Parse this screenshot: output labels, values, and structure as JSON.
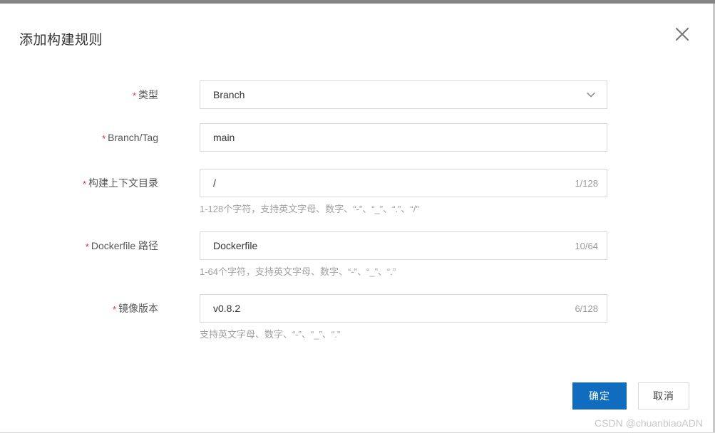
{
  "dialog": {
    "title": "添加构建规则",
    "close_icon": "close-icon"
  },
  "form": {
    "fields": [
      {
        "label": "类型",
        "required_mark": "*",
        "value": "Branch",
        "control": "select",
        "icon": "chevron-down-icon",
        "counter": "",
        "helper": ""
      },
      {
        "label": "Branch/Tag",
        "required_mark": "*",
        "value": "main",
        "control": "text",
        "counter": "",
        "helper": ""
      },
      {
        "label": "构建上下文目录",
        "required_mark": "*",
        "value": "/",
        "control": "text",
        "counter": "1/128",
        "helper": "1-128个字符，支持英文字母、数字、“-”、“_”、“.”、“/”"
      },
      {
        "label": "Dockerfile 路径",
        "required_mark": "*",
        "value": "Dockerfile",
        "control": "text",
        "counter": "10/64",
        "helper": "1-64个字符，支持英文字母、数字、“-”、“_”、“.”"
      },
      {
        "label": "镜像版本",
        "required_mark": "*",
        "value": "v0.8.2",
        "control": "text",
        "counter": "6/128",
        "helper": "支持英文字母、数字、“-”、“_”、“.”"
      }
    ]
  },
  "footer": {
    "confirm_label": "确定",
    "cancel_label": "取消"
  },
  "watermark": "CSDN @chuanbiaoADN",
  "colors": {
    "primary": "#0f6cbf",
    "required": "#e03131",
    "border": "#d9d9d9",
    "helper_text": "#a0a0a0",
    "top_strip": "#858585"
  }
}
